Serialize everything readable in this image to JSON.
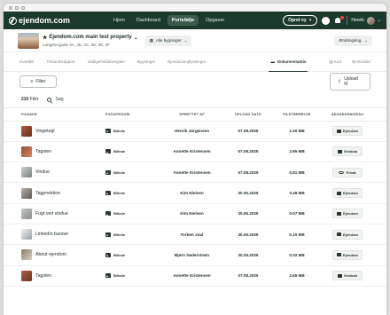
{
  "brand": {
    "logo_text": "ejendom.com"
  },
  "nav": {
    "items": [
      {
        "label": "Hjem",
        "active": false
      },
      {
        "label": "Dashboard",
        "active": false
      },
      {
        "label": "Portefølje",
        "active": true
      },
      {
        "label": "Opgaver",
        "active": false
      }
    ],
    "create_label": "Opret ny",
    "user_name": "Henrik",
    "notification_badge_color": "#e2473a"
  },
  "property": {
    "title": "Ejendom.com main test property",
    "address": "Langebrogade 3A, 3B, 3C, 3D, 3E, 3F",
    "buildings_label": "Alle bygninger",
    "ownership_label": "Ændringslog"
  },
  "tabs": {
    "left": [
      "Overblik",
      "Tilstandsrapport",
      "Vedligeholdelsesplan",
      "Bygninger",
      "Ejendomsoplysninger"
    ],
    "active": "Dokumentarkiv",
    "right": [
      "Kort",
      "Struktur"
    ]
  },
  "toolbar": {
    "filter_label": "Filter",
    "upload_label": "Upload fil"
  },
  "list": {
    "count": "210",
    "count_suffix": "Filer",
    "search_placeholder": "Søg"
  },
  "table": {
    "headers": {
      "name": "FILNAVN",
      "type": "FILKATEGORI",
      "by": "OPRETTET AF",
      "date": "UPLOAD DATO",
      "size": "FILSTØRRELSE",
      "access": "ADGANGSNIVEAU"
    },
    "rows": [
      {
        "name": "Vingetegl",
        "type": "Billede",
        "by": "Henrik Jørgensen",
        "date": "07.08.2025",
        "size": "1.00 MB",
        "access": "Ejendom",
        "access_icon": "building-icon"
      },
      {
        "name": "Tagsten",
        "type": "Billede",
        "by": "Annette Kristensen",
        "date": "07.08.2025",
        "size": "2.65 MB",
        "access": "Selskab",
        "access_icon": "company-icon"
      },
      {
        "name": "Vindue",
        "type": "Billede",
        "by": "Annette Kristensen",
        "date": "07.08.2025",
        "size": "0.81 MB",
        "access": "Privat",
        "access_icon": "eye-icon"
      },
      {
        "name": "Tagpnektion",
        "type": "Billede",
        "by": "Kim Nielsen",
        "date": "30.05.2025",
        "size": "0.48 MB",
        "access": "Ejendom",
        "access_icon": "building-icon"
      },
      {
        "name": "Fugt ved vindue",
        "type": "Billede",
        "by": "Kim Nielsen",
        "date": "30.05.2025",
        "size": "0.07 MB",
        "access": "Ejendom",
        "access_icon": "building-icon"
      },
      {
        "name": "LinkedIn banner",
        "type": "Billede",
        "by": "Torben Juul",
        "date": "30.05.2025",
        "size": "0.10 MB",
        "access": "Ejendom",
        "access_icon": "building-icon"
      },
      {
        "name": "About ejendom",
        "type": "Billede",
        "by": "Bjørn Søderstrøm",
        "date": "30.05.2025",
        "size": "0.32 MB",
        "access": "Ejendom",
        "access_icon": "building-icon"
      },
      {
        "name": "Tagsten",
        "type": "Billede",
        "by": "Annette Kristensen",
        "date": "07.08.2025",
        "size": "2.65 MB",
        "access": "Selskab",
        "access_icon": "company-icon"
      }
    ]
  },
  "colors": {
    "nav_bg": "#1c3a2c",
    "accent": "#1c3a2c"
  }
}
